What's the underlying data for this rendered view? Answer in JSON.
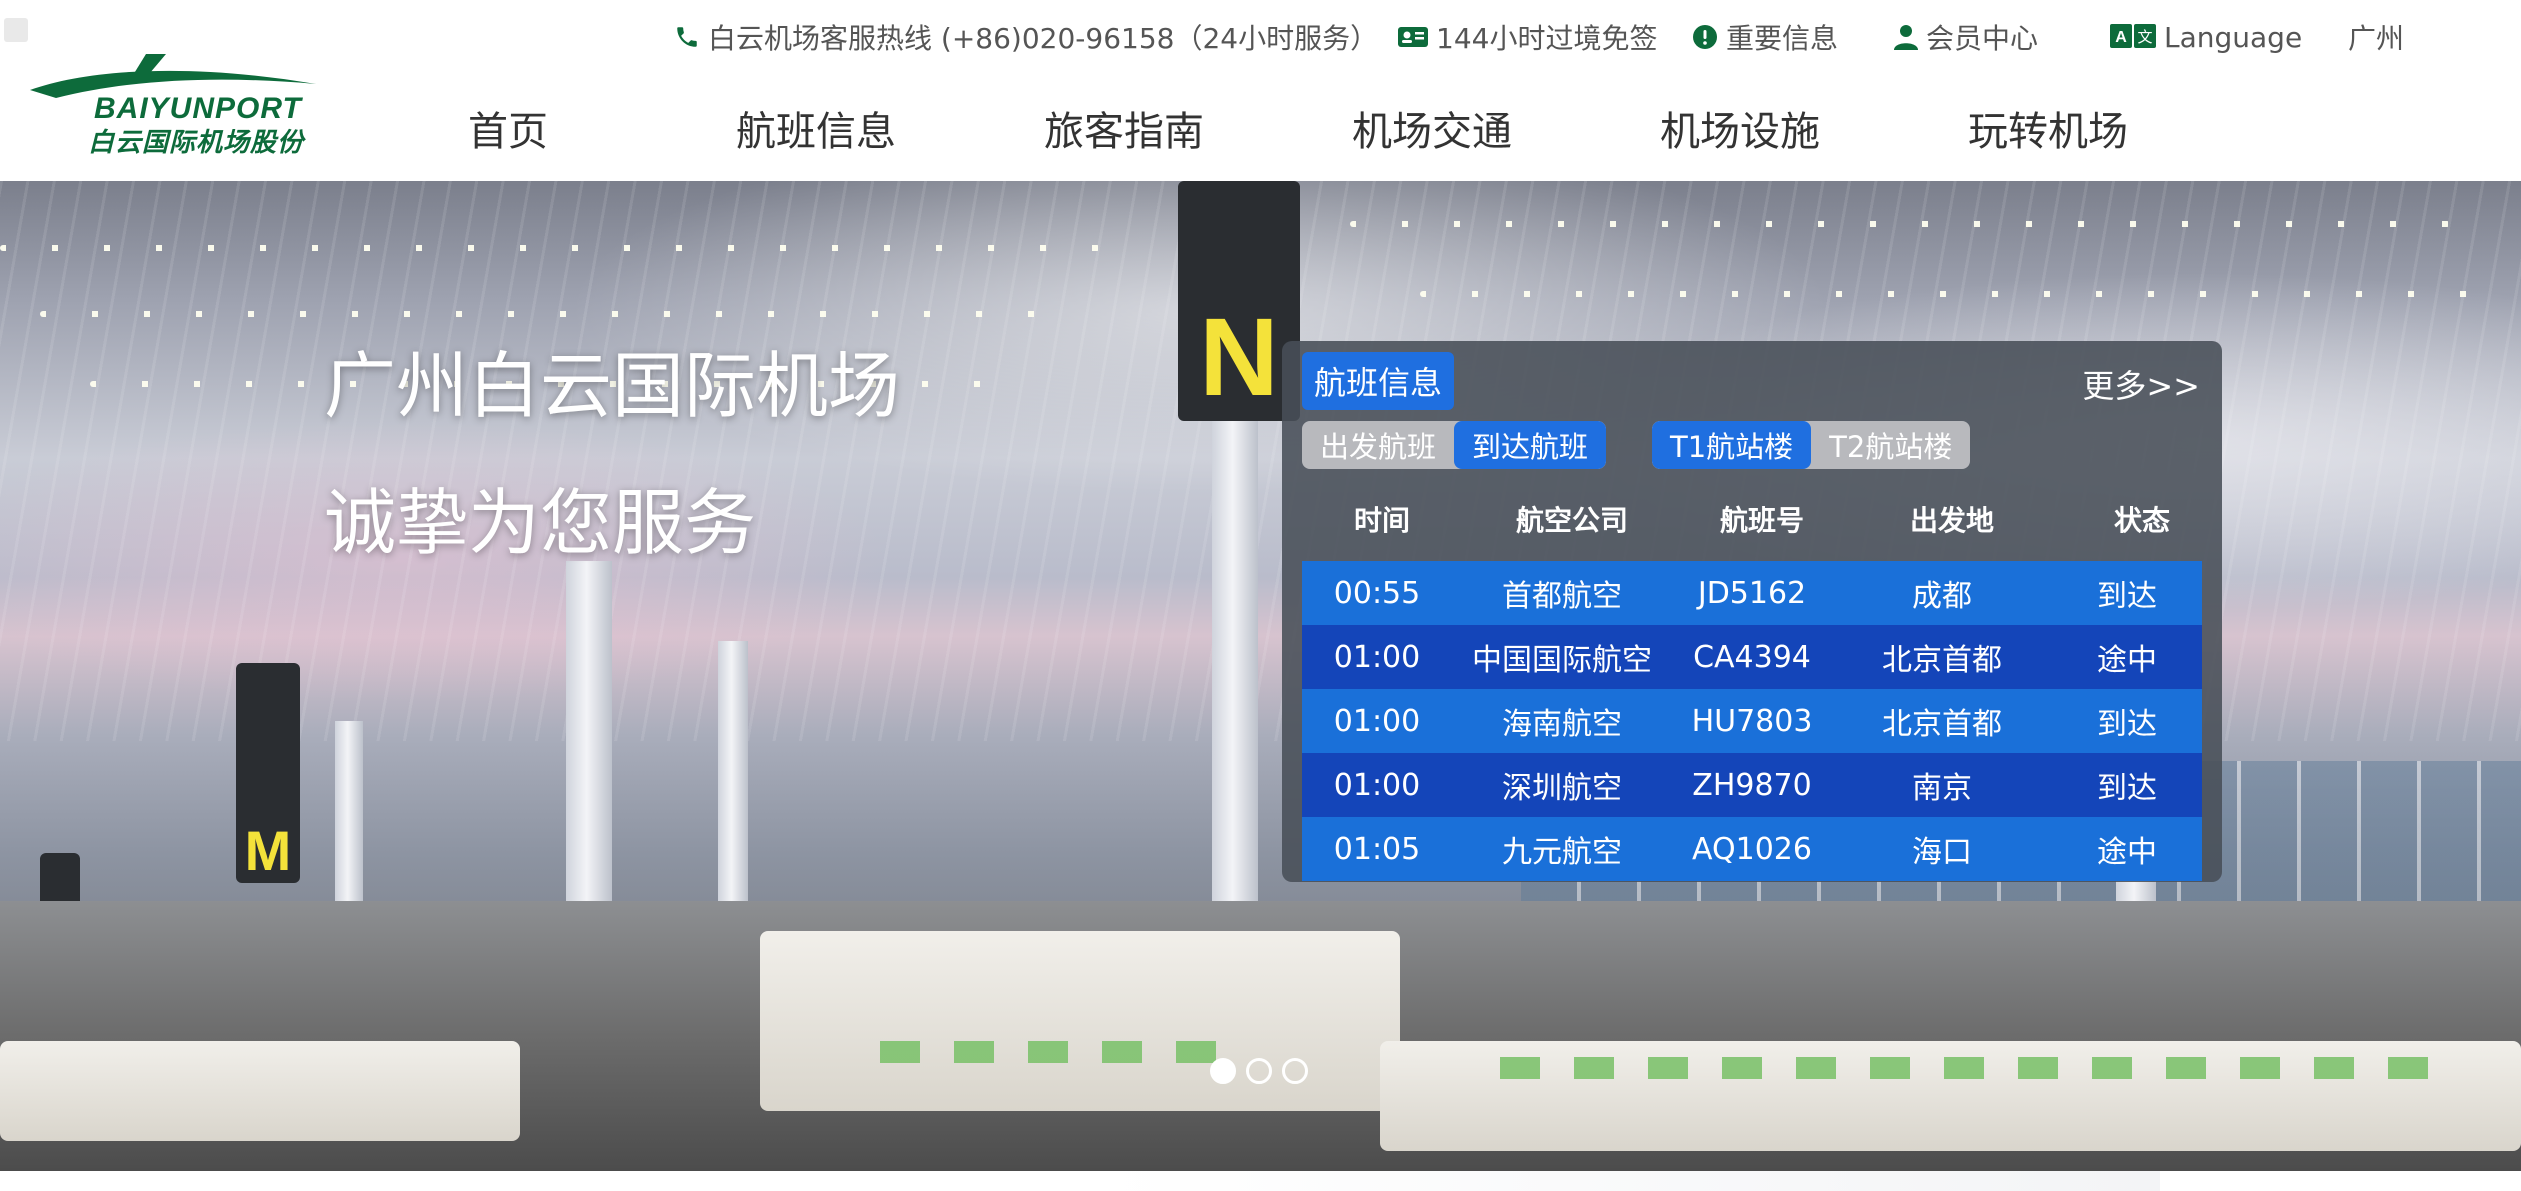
{
  "logo": {
    "name_en": "BAIYUNPORT",
    "name_cn": "白云国际机场股份"
  },
  "topbar": {
    "hotline": "白云机场客服热线 (+86)020-96158（24小时服务）",
    "visa_free": "144小时过境免签",
    "important_info": "重要信息",
    "member_center": "会员中心",
    "language": "Language",
    "city": "广州"
  },
  "nav": {
    "items": [
      "首页",
      "航班信息",
      "旅客指南",
      "机场交通",
      "机场设施",
      "玩转机场"
    ]
  },
  "hero": {
    "line1": "广州白云国际机场",
    "line2": "诚挚为您服务"
  },
  "flight_panel": {
    "title": "航班信息",
    "more": "更多>>",
    "tabs_direction": [
      "出发航班",
      "到达航班"
    ],
    "active_direction": "到达航班",
    "tabs_terminal": [
      "T1航站楼",
      "T2航站楼"
    ],
    "active_terminal": "T1航站楼",
    "columns": [
      "时间",
      "航空公司",
      "航班号",
      "出发地",
      "状态"
    ],
    "rows": [
      {
        "time": "00:55",
        "airline": "首都航空",
        "flight": "JD5162",
        "origin": "成都",
        "status": "到达"
      },
      {
        "time": "01:00",
        "airline": "中国国际航空",
        "flight": "CA4394",
        "origin": "北京首都",
        "status": "途中"
      },
      {
        "time": "01:00",
        "airline": "海南航空",
        "flight": "HU7803",
        "origin": "北京首都",
        "status": "到达"
      },
      {
        "time": "01:00",
        "airline": "深圳航空",
        "flight": "ZH9870",
        "origin": "南京",
        "status": "到达"
      },
      {
        "time": "01:05",
        "airline": "九元航空",
        "flight": "AQ1026",
        "origin": "海口",
        "status": "途中"
      }
    ]
  },
  "carousel": {
    "slides": 3,
    "active": 1
  },
  "colors": {
    "brand_green": "#0d6b3b",
    "accent_blue": "#1f6fe0",
    "row_blue_dark": "#1445b9"
  },
  "icons": {
    "hotline": "phone-icon",
    "visa_free": "id-card-icon",
    "important_info": "exclamation-circle-icon",
    "member_center": "user-icon",
    "language": "language-icon"
  }
}
